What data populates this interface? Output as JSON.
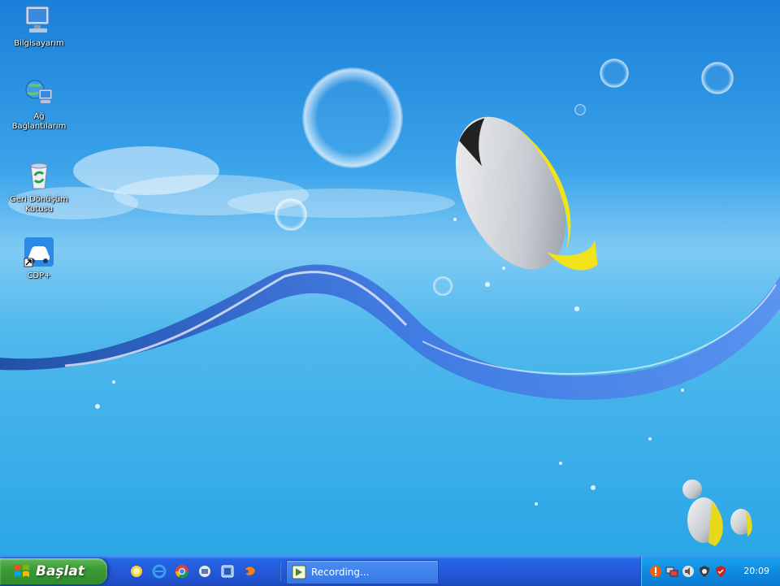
{
  "desktop": {
    "icons": [
      {
        "label": "Bilgisayarım"
      },
      {
        "label": "Ağ Bağlantılarım"
      },
      {
        "label": "Geri Dönüşüm Kutusu"
      },
      {
        "label": "CDP+"
      }
    ]
  },
  "taskbar": {
    "start_label": "Başlat",
    "quick_launch": [
      "desktop-icon",
      "ie-icon",
      "chrome-icon",
      "mail-icon",
      "app-icon",
      "firefox-icon"
    ],
    "tasks": [
      {
        "label": "Recording..."
      }
    ],
    "tray_icons": [
      "alert-icon",
      "network-icon",
      "volume-icon",
      "security-icon",
      "update-icon"
    ],
    "clock": "20:09"
  },
  "colors": {
    "taskbar_blue": "#2459d8",
    "start_green": "#3c9c36",
    "tray_blue": "#0f8be0"
  }
}
